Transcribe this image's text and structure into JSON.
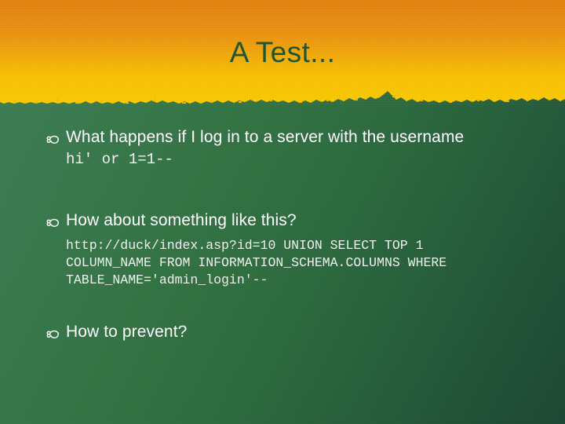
{
  "slide": {
    "title": "A Test...",
    "title_color": "#1d5632",
    "header_gradient_top": "#e3830d",
    "header_gradient_bottom": "#fbc900",
    "body_background": "#2f6e42",
    "body_text_color": "#ffffff",
    "bullet_glyph_name": "curly-bookmark-bullet"
  },
  "content": {
    "blocks": [
      {
        "bullet": "❧",
        "text": "What happens if I log in to a server with the username",
        "code": "hi' or 1=1--"
      },
      {
        "bullet": "❧",
        "text": "How about something like this?",
        "code": "http://duck/index.asp?id=10 UNION SELECT TOP 1 COLUMN_NAME FROM INFORMATION_SCHEMA.COLUMNS WHERE TABLE_NAME='admin_login'--"
      },
      {
        "bullet": "❧",
        "text": "How to prevent?",
        "code": ""
      }
    ]
  }
}
